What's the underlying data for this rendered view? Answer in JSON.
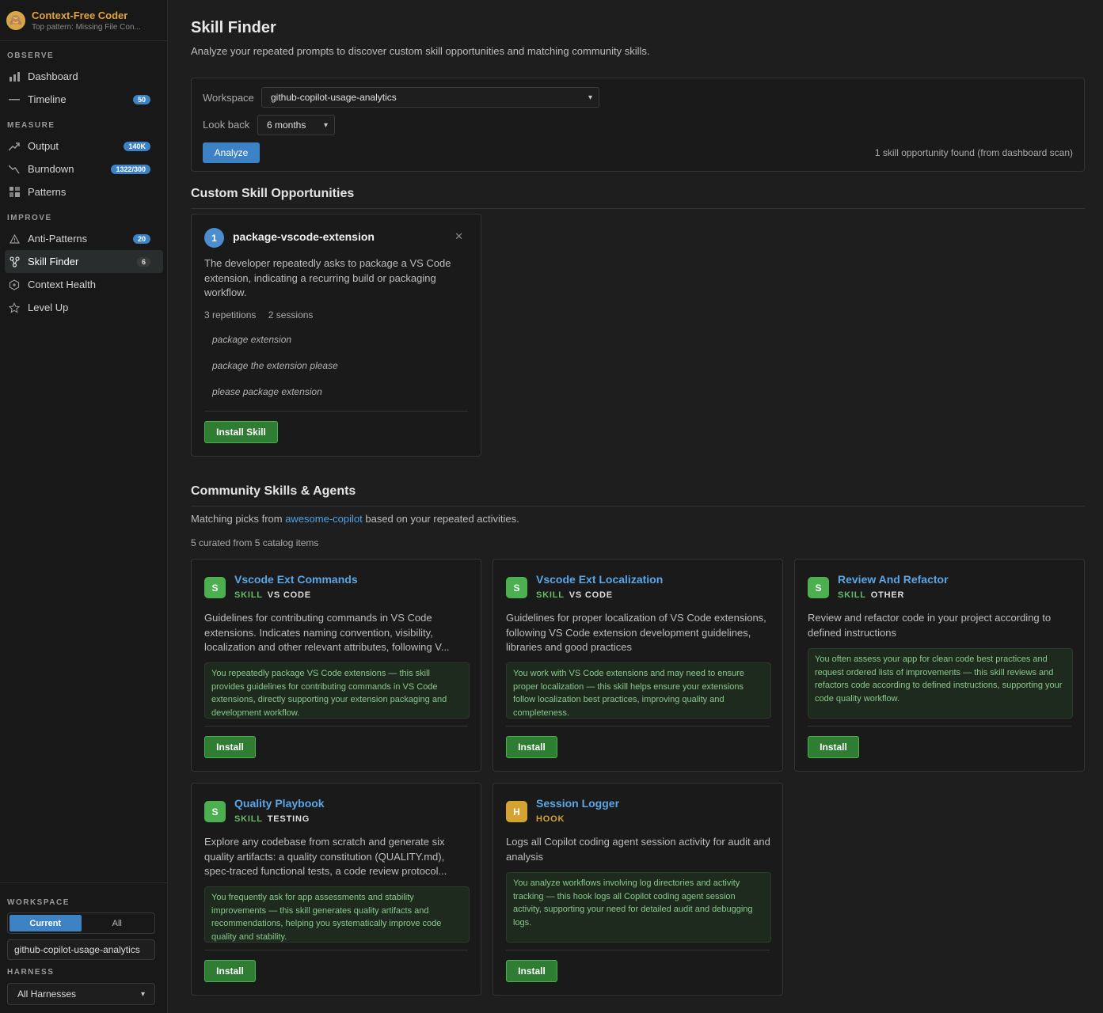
{
  "brand": {
    "logo_icon": "monkey-face-icon",
    "title": "Context-Free Coder",
    "subtitle": "Top pattern: Missing File Con..."
  },
  "sidebar": {
    "sections": {
      "observe": "OBSERVE",
      "measure": "MEASURE",
      "improve": "IMPROVE"
    },
    "items": [
      {
        "label": "Dashboard",
        "icon": "bar-chart-icon",
        "badge": ""
      },
      {
        "label": "Timeline",
        "icon": "line-icon",
        "badge": "50"
      },
      {
        "label": "Output",
        "icon": "trend-up-icon",
        "badge": "140K"
      },
      {
        "label": "Burndown",
        "icon": "trend-down-icon",
        "badge": "1322/300"
      },
      {
        "label": "Patterns",
        "icon": "grid-icon",
        "badge": ""
      },
      {
        "label": "Anti-Patterns",
        "icon": "warning-icon",
        "badge": "20"
      },
      {
        "label": "Skill Finder",
        "icon": "branch-icon",
        "badge": "6"
      },
      {
        "label": "Context Health",
        "icon": "hexagon-icon",
        "badge": ""
      },
      {
        "label": "Level Up",
        "icon": "star-icon",
        "badge": ""
      }
    ],
    "active": "Skill Finder",
    "workspace_label": "WORKSPACE",
    "workspace_scope": [
      "Current",
      "All"
    ],
    "workspace_value": "github-copilot-usage-analytics",
    "harness_label": "HARNESS",
    "harness_value": "All Harnesses"
  },
  "page": {
    "title": "Skill Finder",
    "description": "Analyze your repeated prompts to discover custom skill opportunities and matching community skills."
  },
  "controls": {
    "workspace_label": "Workspace",
    "workspace_value": "github-copilot-usage-analytics",
    "lookback_label": "Look back",
    "lookback_value": "6 months",
    "analyze_label": "Analyze",
    "status": "1 skill opportunity found (from dashboard scan)"
  },
  "opportunities": {
    "heading": "Custom Skill Opportunities",
    "items": [
      {
        "number": "1",
        "title": "package-vscode-extension",
        "description": "The developer repeatedly asks to package a VS Code extension, indicating a recurring build or packaging workflow.",
        "repetitions": "3 repetitions",
        "sessions": "2 sessions",
        "examples": [
          "package extension",
          "package the extension please",
          "please package extension"
        ],
        "install_label": "Install Skill"
      }
    ]
  },
  "community": {
    "heading": "Community Skills & Agents",
    "matching_prefix": "Matching picks from ",
    "matching_link": "awesome-copilot",
    "matching_suffix": " based on your repeated activities.",
    "curated": "5 curated from 5 catalog items",
    "install_label": "Install",
    "cards": [
      {
        "icon_letter": "S",
        "title": "Vscode Ext Commands",
        "type": "SKILL",
        "category": "VS CODE",
        "description": "Guidelines for contributing commands in VS Code extensions. Indicates naming convention, visibility, localization and other relevant attributes, following V...",
        "reason": "You repeatedly package VS Code extensions — this skill provides guidelines for contributing commands in VS Code extensions, directly supporting your extension packaging and development workflow."
      },
      {
        "icon_letter": "S",
        "title": "Vscode Ext Localization",
        "type": "SKILL",
        "category": "VS CODE",
        "description": "Guidelines for proper localization of VS Code extensions, following VS Code extension development guidelines, libraries and good practices",
        "reason": "You work with VS Code extensions and may need to ensure proper localization — this skill helps ensure your extensions follow localization best practices, improving quality and completeness."
      },
      {
        "icon_letter": "S",
        "title": "Review And Refactor",
        "type": "SKILL",
        "category": "OTHER",
        "description": "Review and refactor code in your project according to defined instructions",
        "reason": "You often assess your app for clean code best practices and request ordered lists of improvements — this skill reviews and refactors code according to defined instructions, supporting your code quality workflow."
      },
      {
        "icon_letter": "S",
        "title": "Quality Playbook",
        "type": "SKILL",
        "category": "TESTING",
        "description": "Explore any codebase from scratch and generate six quality artifacts: a quality constitution (QUALITY.md), spec-traced functional tests, a code review protocol...",
        "reason": "You frequently ask for app assessments and stability improvements — this skill generates quality artifacts and recommendations, helping you systematically improve code quality and stability."
      },
      {
        "icon_letter": "H",
        "title": "Session Logger",
        "type": "HOOK",
        "category": "",
        "description": "Logs all Copilot coding agent session activity for audit and analysis",
        "reason": "You analyze workflows involving log directories and activity tracking — this hook logs all Copilot coding agent session activity, supporting your need for detailed audit and debugging logs."
      }
    ]
  }
}
